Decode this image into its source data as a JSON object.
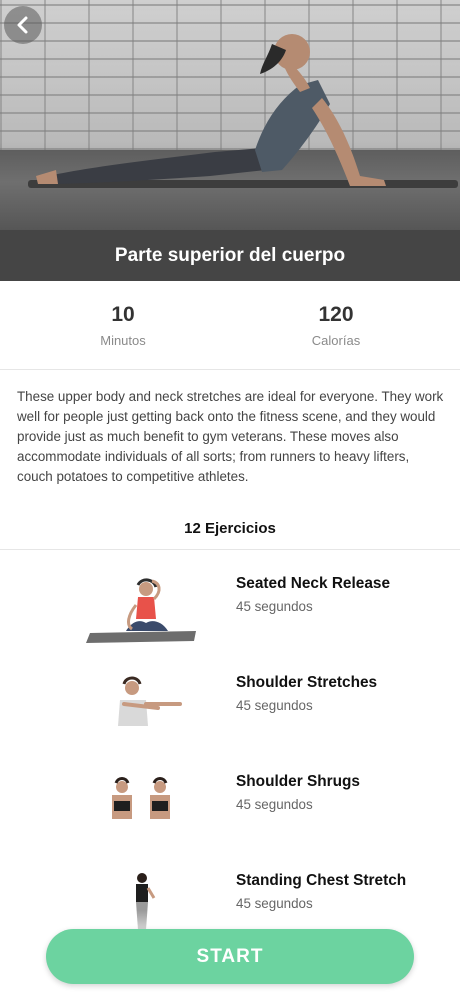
{
  "header": {
    "title": "Parte superior del cuerpo",
    "back_icon": "chevron-left-icon"
  },
  "stats": [
    {
      "value": "10",
      "label": "Minutos"
    },
    {
      "value": "120",
      "label": "Calorías"
    }
  ],
  "description": "These upper body and neck stretches are ideal for everyone. They work well for people just getting back onto the fitness scene, and they would provide just as much benefit to gym veterans. These moves also accommodate individuals of all sorts; from runners to heavy lifters, couch potatoes to competitive athletes.",
  "exercise_count": "12 Ejercicios",
  "exercises": [
    {
      "name": "Seated Neck Release",
      "duration": "45 segundos"
    },
    {
      "name": "Shoulder Stretches",
      "duration": "45 segundos"
    },
    {
      "name": "Shoulder Shrugs",
      "duration": "45 segundos"
    },
    {
      "name": "Standing Chest Stretch",
      "duration": "45 segundos"
    }
  ],
  "start_label": "START",
  "colors": {
    "accent": "#6cd3a0",
    "title_bar": "#454545"
  }
}
